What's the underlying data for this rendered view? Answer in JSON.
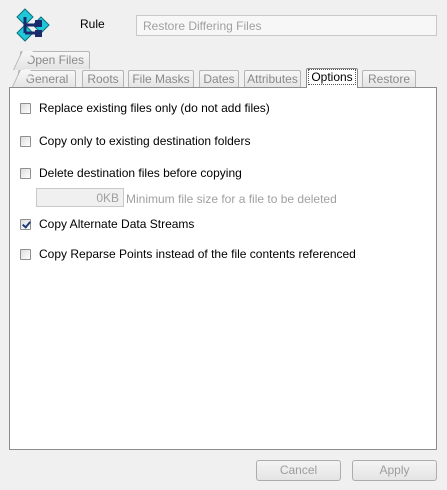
{
  "header": {
    "rule_label": "Rule",
    "rule_name_value": "Restore Differing Files"
  },
  "tabs_row1": [
    {
      "label": "Open Files"
    }
  ],
  "tabs_row2": [
    {
      "label": "General"
    },
    {
      "label": "Roots"
    },
    {
      "label": "File Masks"
    },
    {
      "label": "Dates"
    },
    {
      "label": "Attributes"
    },
    {
      "label": "Options",
      "active": true
    },
    {
      "label": "Restore"
    }
  ],
  "options": {
    "replace_existing": {
      "label": "Replace existing files only (do not add files)",
      "checked": false
    },
    "copy_existing_folders": {
      "label": "Copy only to existing destination folders",
      "checked": false
    },
    "delete_before_copy": {
      "label": "Delete destination files before copying",
      "checked": false
    },
    "min_size_value": "0KB",
    "min_size_hint": "Minimum file size for a file to be deleted",
    "alternate_streams": {
      "label": "Copy Alternate Data Streams",
      "checked": true
    },
    "reparse_points": {
      "label": "Copy Reparse Points instead of the file contents referenced",
      "checked": false
    }
  },
  "buttons": {
    "cancel": "Cancel",
    "apply": "Apply"
  },
  "colors": {
    "window_bg": "#f0f0f0",
    "panel_bg": "#ffffff",
    "disabled_text": "#a0a0a0",
    "icon_cyan": "#1ec8d8",
    "icon_navy": "#1a2a6c"
  },
  "icons": {
    "app": "sync-rule-icon"
  }
}
